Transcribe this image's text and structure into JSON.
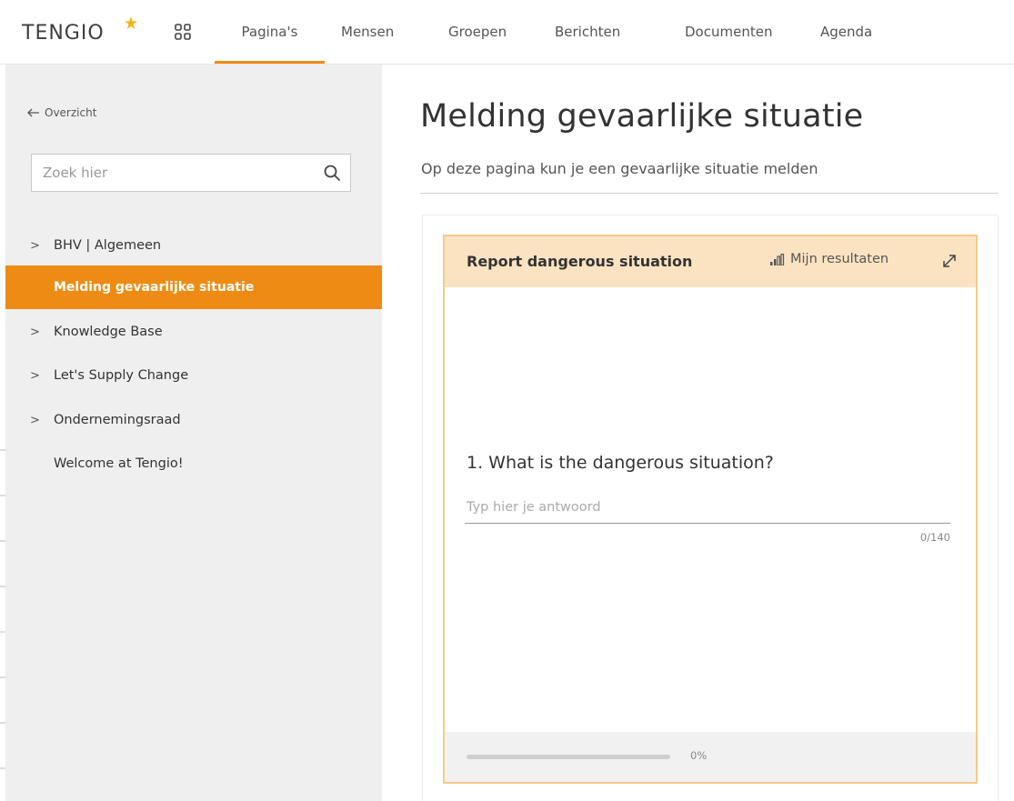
{
  "brand": {
    "name": "TENGIO",
    "star_color": "#f2b31a"
  },
  "icons": {
    "apps": "apps-grid-icon",
    "search": "search-icon",
    "back": "arrow-left-icon",
    "chevron": "chevron-right-icon",
    "results": "bar-chart-icon",
    "expand": "expand-icon"
  },
  "colors": {
    "accent": "#ee8b14",
    "card_header": "#fbe3c2",
    "card_border": "#f6c98a",
    "sidebar_bg": "#efeff0"
  },
  "nav": {
    "tabs": [
      {
        "label": "Pagina's",
        "active": true
      },
      {
        "label": "Mensen",
        "active": false
      },
      {
        "label": "Groepen",
        "active": false
      },
      {
        "label": "Berichten",
        "active": false
      },
      {
        "label": "Documenten",
        "active": false
      },
      {
        "label": "Agenda",
        "active": false
      }
    ]
  },
  "sidebar": {
    "back_label": "Overzicht",
    "search_placeholder": "Zoek hier",
    "items": [
      {
        "label": "BHV | Algemeen",
        "has_children": true,
        "active": false
      },
      {
        "label": "Melding gevaarlijke situatie",
        "has_children": false,
        "active": true
      },
      {
        "label": "Knowledge Base",
        "has_children": true,
        "active": false
      },
      {
        "label": "Let's Supply Change",
        "has_children": true,
        "active": false
      },
      {
        "label": "Ondernemingsraad",
        "has_children": true,
        "active": false
      },
      {
        "label": "Welcome at Tengio!",
        "has_children": false,
        "active": false
      }
    ]
  },
  "main": {
    "title": "Melding gevaarlijke situatie",
    "subtitle": "Op deze pagina kun je een gevaarlijke situatie melden"
  },
  "form": {
    "title": "Report dangerous situation",
    "results_label": "Mijn resultaten",
    "question": "1. What is the dangerous situation?",
    "answer_value": "",
    "answer_placeholder": "Typ hier je antwoord",
    "char_count": "0/140",
    "progress_fraction": 0,
    "progress_label": "0%"
  }
}
